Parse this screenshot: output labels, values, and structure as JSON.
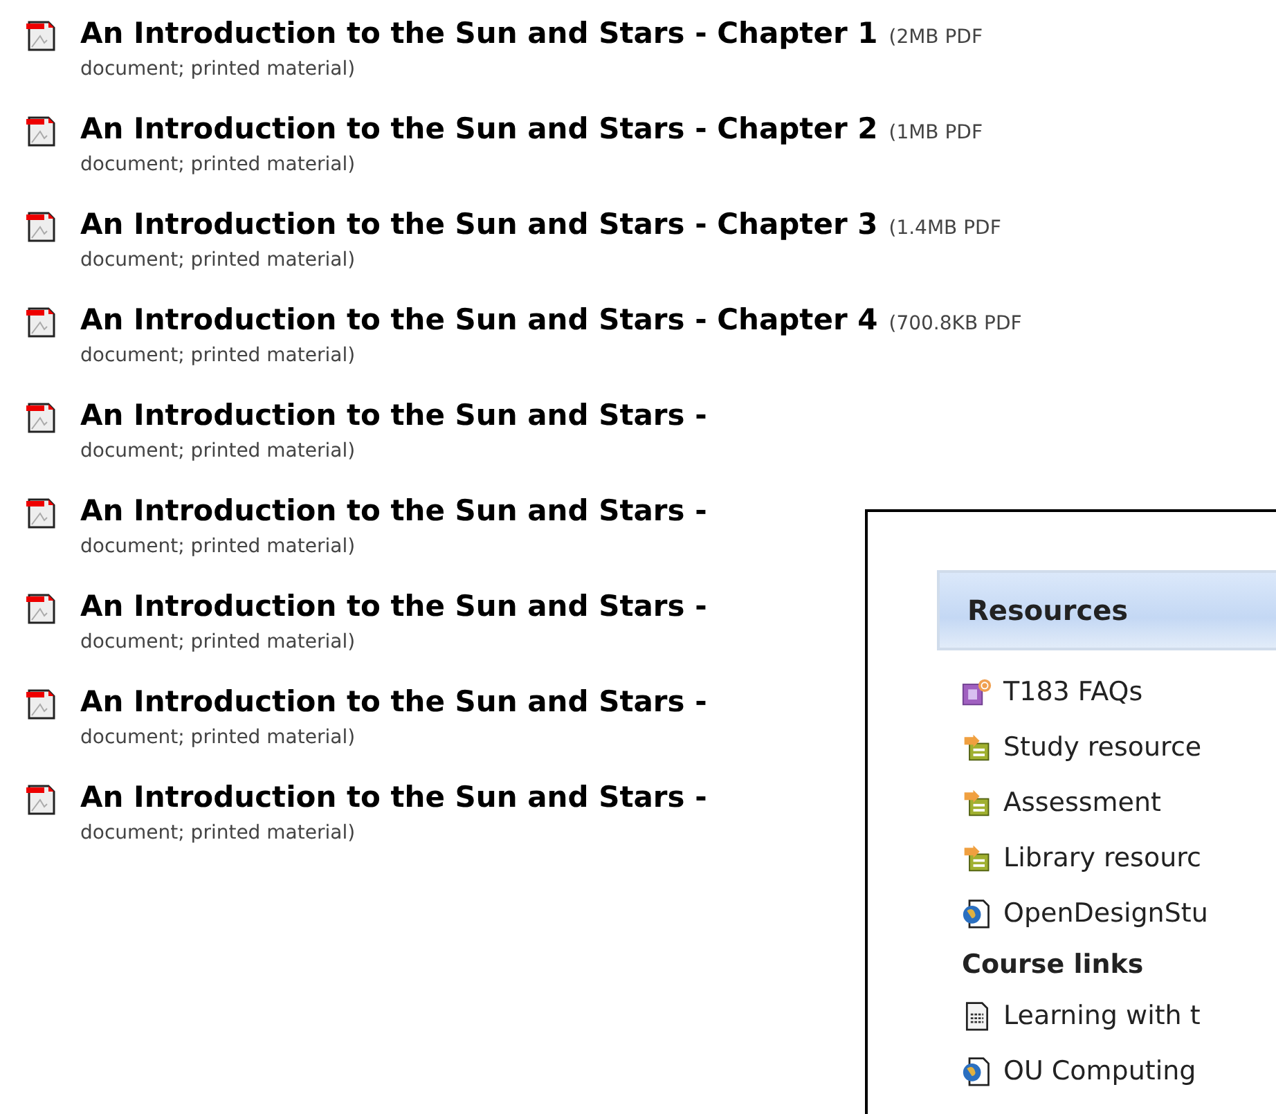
{
  "documents": [
    {
      "title": "An Introduction to the Sun and Stars - Chapter 1",
      "size": "(2MB PDF",
      "description": "document; printed material)"
    },
    {
      "title": "An Introduction to the Sun and Stars - Chapter 2",
      "size": "(1MB PDF",
      "description": "document; printed material)"
    },
    {
      "title": "An Introduction to the Sun and Stars - Chapter 3",
      "size": "(1.4MB PDF",
      "description": "document; printed material)"
    },
    {
      "title": "An Introduction to the Sun and Stars - Chapter 4",
      "size": "(700.8KB PDF",
      "description": "document; printed material)"
    },
    {
      "title": "An Introduction to the Sun and Stars -",
      "description": "document; printed material)"
    },
    {
      "title": "An Introduction to the Sun and Stars -",
      "description": "document; printed material)"
    },
    {
      "title": "An Introduction to the Sun and Stars -",
      "description": "document; printed material)"
    },
    {
      "title": "An Introduction to the Sun and Stars -",
      "description": "document; printed material)"
    },
    {
      "title": "An Introduction to the Sun and Stars -",
      "description": "document; printed material)"
    }
  ],
  "panel": {
    "title": "Resources",
    "items": [
      {
        "kind": "faq",
        "label": "T183 FAQs"
      },
      {
        "kind": "folder",
        "label": "Study resource"
      },
      {
        "kind": "folder",
        "label": "Assessment"
      },
      {
        "kind": "folder",
        "label": "Library resourc"
      },
      {
        "kind": "web",
        "label": "OpenDesignStu"
      },
      {
        "kind": "heading",
        "label": "Course links"
      },
      {
        "kind": "page",
        "label": "Learning with t"
      },
      {
        "kind": "web",
        "label": "OU Computing"
      }
    ]
  }
}
